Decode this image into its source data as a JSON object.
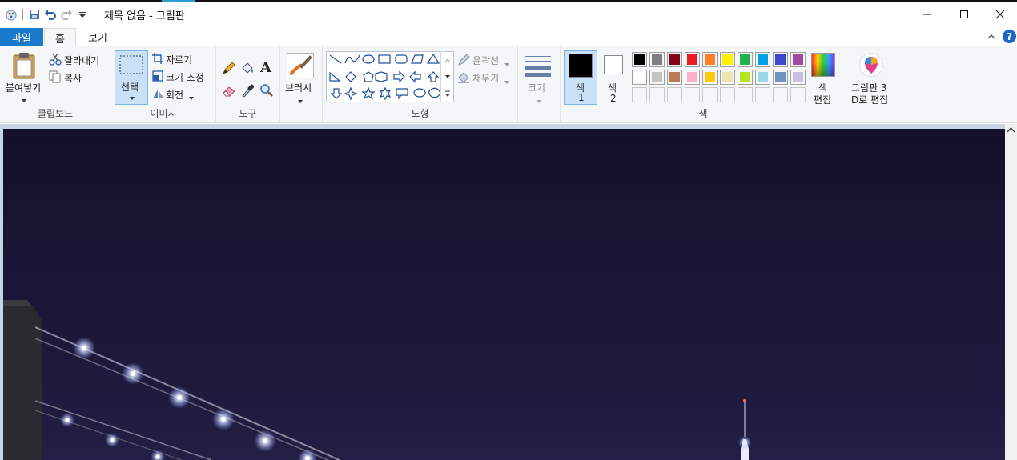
{
  "window": {
    "title": "제목 없음 - 그림판",
    "minimize_icon": "minimize-icon",
    "maximize_icon": "maximize-icon",
    "close_icon": "close-icon"
  },
  "quick_access": {
    "items": [
      "paint-app-icon",
      "save-icon",
      "undo-icon",
      "redo-icon",
      "customize-dropdown-icon"
    ]
  },
  "tabs": {
    "file": "파일",
    "home": "홈",
    "view": "보기"
  },
  "ribbon": {
    "clipboard": {
      "paste": "붙여넣기",
      "cut": "잘라내기",
      "copy": "복사",
      "group": "클립보드"
    },
    "image": {
      "select": "선택",
      "crop": "자르기",
      "resize": "크기 조정",
      "rotate": "회전",
      "group": "이미지"
    },
    "tools": {
      "group": "도구",
      "items": [
        "pencil-icon",
        "fill-icon",
        "text-icon",
        "eraser-icon",
        "color-picker-icon",
        "magnifier-icon"
      ]
    },
    "brushes": {
      "label": "브러시"
    },
    "shapes": {
      "outline": "윤곽선",
      "fill": "채우기",
      "group": "도형"
    },
    "size": {
      "label": "크기"
    },
    "colors": {
      "color1": "색\n1",
      "color1_line1": "색",
      "color1_line2": "1",
      "color2_line1": "색",
      "color2_line2": "2",
      "edit_line1": "색",
      "edit_line2": "편집",
      "group": "색",
      "color1_value": "#000000",
      "color2_value": "#ffffff",
      "palette_row1": [
        "#000000",
        "#7f7f7f",
        "#880015",
        "#ed1c24",
        "#ff7f27",
        "#fff200",
        "#22b14c",
        "#00a2e8",
        "#3f48cc",
        "#a349a4"
      ],
      "palette_row2": [
        "#ffffff",
        "#c3c3c3",
        "#b97a57",
        "#ffaec9",
        "#ffc90e",
        "#efe4b0",
        "#b5e61d",
        "#99d9ea",
        "#7092be",
        "#c8bfe7"
      ]
    },
    "paint3d": {
      "line1": "그림판 3",
      "line2": "D로 편집"
    }
  },
  "accent": "#1979ca"
}
